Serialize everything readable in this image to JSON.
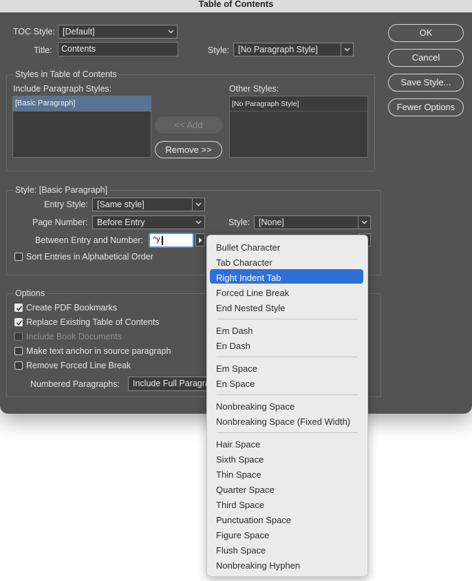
{
  "window": {
    "title": "Table of Contents"
  },
  "toc_style": {
    "label": "TOC Style:",
    "value": "[Default]"
  },
  "title_field": {
    "label": "Title:",
    "value": "Contents"
  },
  "title_style": {
    "label": "Style:",
    "value": "[No Paragraph Style]"
  },
  "buttons": {
    "ok": "OK",
    "cancel": "Cancel",
    "save_style": "Save Style...",
    "fewer_options": "Fewer Options"
  },
  "styles_group": {
    "title": "Styles in Table of Contents",
    "include_label": "Include Paragraph Styles:",
    "include_items": [
      "[Basic Paragraph]"
    ],
    "add_button": "<< Add",
    "remove_button": "Remove >>",
    "other_label": "Other Styles:",
    "other_items": [
      "[No Paragraph Style]"
    ]
  },
  "style_group": {
    "title": "Style: [Basic Paragraph]",
    "entry_style_label": "Entry Style:",
    "entry_style_value": "[Same style]",
    "page_number_label": "Page Number:",
    "page_number_value": "Before Entry",
    "page_style_label": "Style:",
    "page_style_value": "[None]",
    "between_label": "Between Entry and Number:",
    "between_value": "^y",
    "sort_label": "Sort Entries in Alphabetical Order",
    "sort_checked": false
  },
  "options_group": {
    "title": "Options",
    "create_pdf": {
      "label": "Create PDF Bookmarks",
      "checked": true
    },
    "replace_existing": {
      "label": "Replace Existing Table of Contents",
      "checked": true
    },
    "include_book": {
      "label": "Include Book Documents",
      "checked": false,
      "disabled": true
    },
    "make_anchor": {
      "label": "Make text anchor in source paragraph",
      "checked": false
    },
    "remove_forced": {
      "label": "Remove Forced Line Break",
      "checked": false
    },
    "numbered_label": "Numbered Paragraphs:",
    "numbered_value": "Include Full Paragra"
  },
  "special_menu": {
    "selected": "Right Indent Tab",
    "groups": [
      [
        "Bullet Character",
        "Tab Character",
        "Right Indent Tab",
        "Forced Line Break",
        "End Nested Style"
      ],
      [
        "Em Dash",
        "En Dash"
      ],
      [
        "Em Space",
        "En Space"
      ],
      [
        "Nonbreaking Space",
        "Nonbreaking Space (Fixed Width)"
      ],
      [
        "Hair Space",
        "Sixth Space",
        "Thin Space",
        "Quarter Space",
        "Third Space",
        "Punctuation Space",
        "Figure Space",
        "Flush Space",
        "Nonbreaking Hyphen"
      ]
    ]
  }
}
